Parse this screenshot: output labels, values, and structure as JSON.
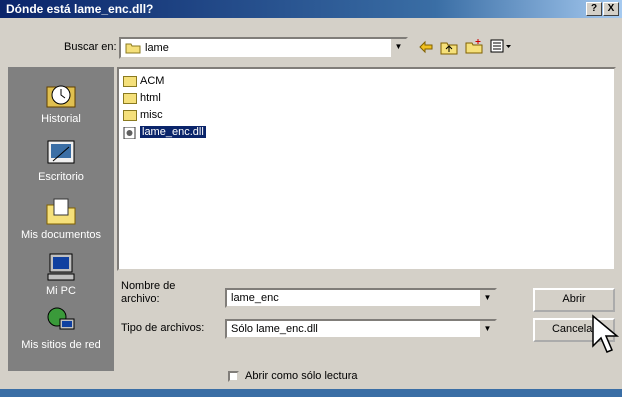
{
  "window": {
    "title": "Dónde está lame_enc.dll?",
    "help_btn": "?",
    "close_btn": "X"
  },
  "toolbar": {
    "lookin_label": "Buscar en:",
    "lookin_value": "lame"
  },
  "places": [
    {
      "label": "Historial",
      "icon": "history-icon"
    },
    {
      "label": "Escritorio",
      "icon": "desktop-icon"
    },
    {
      "label": "Mis documentos",
      "icon": "documents-icon"
    },
    {
      "label": "Mi PC",
      "icon": "computer-icon"
    },
    {
      "label": "Mis sitios de red",
      "icon": "network-icon"
    }
  ],
  "files": [
    {
      "name": "ACM",
      "type": "folder"
    },
    {
      "name": "html",
      "type": "folder"
    },
    {
      "name": "misc",
      "type": "folder"
    },
    {
      "name": "lame_enc.dll",
      "type": "dll",
      "selected": true
    }
  ],
  "form": {
    "filename_label": "Nombre de archivo:",
    "filename_value": "lame_enc",
    "filetype_label": "Tipo de archivos:",
    "filetype_value": "Sólo lame_enc.dll",
    "readonly_label": "Abrir como sólo lectura"
  },
  "buttons": {
    "open": "Abrir",
    "cancel": "Cancelar"
  }
}
